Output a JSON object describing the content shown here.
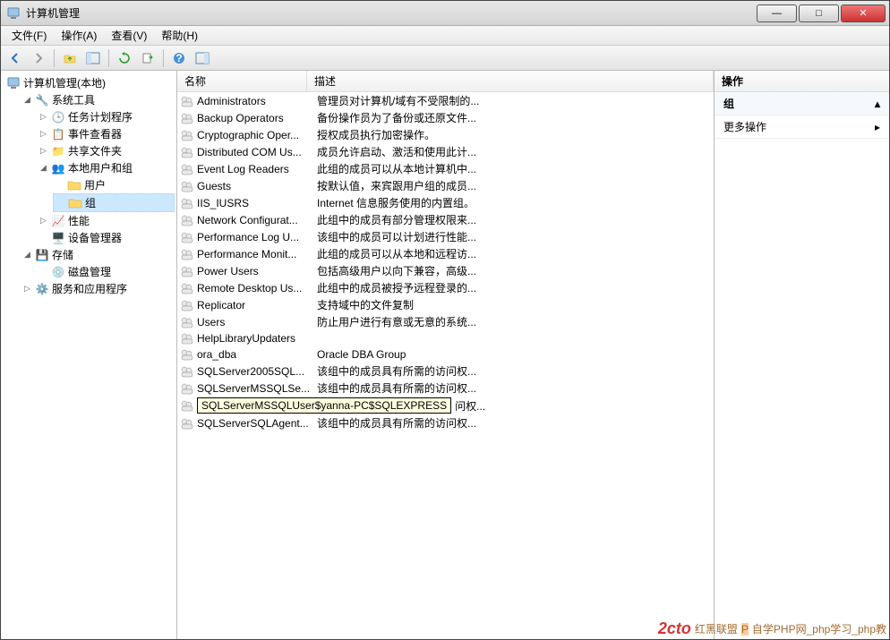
{
  "window": {
    "title": "计算机管理"
  },
  "menu": {
    "file": "文件(F)",
    "action": "操作(A)",
    "view": "查看(V)",
    "help": "帮助(H)"
  },
  "tree": {
    "root": "计算机管理(本地)",
    "tools": "系统工具",
    "task": "任务计划程序",
    "event": "事件查看器",
    "share": "共享文件夹",
    "usersgroups": "本地用户和组",
    "users": "用户",
    "groups": "组",
    "perf": "性能",
    "devmgr": "设备管理器",
    "storage": "存储",
    "diskmgr": "磁盘管理",
    "services": "服务和应用程序"
  },
  "list": {
    "header_name": "名称",
    "header_desc": "描述",
    "rows": [
      {
        "name": "Administrators",
        "desc": "管理员对计算机/域有不受限制的..."
      },
      {
        "name": "Backup Operators",
        "desc": "备份操作员为了备份或还原文件..."
      },
      {
        "name": "Cryptographic Oper...",
        "desc": "授权成员执行加密操作。"
      },
      {
        "name": "Distributed COM Us...",
        "desc": "成员允许启动、激活和使用此计..."
      },
      {
        "name": "Event Log Readers",
        "desc": "此组的成员可以从本地计算机中..."
      },
      {
        "name": "Guests",
        "desc": "按默认值，来宾跟用户组的成员..."
      },
      {
        "name": "IIS_IUSRS",
        "desc": "Internet 信息服务使用的内置组。"
      },
      {
        "name": "Network Configurat...",
        "desc": "此组中的成员有部分管理权限来..."
      },
      {
        "name": "Performance Log U...",
        "desc": "该组中的成员可以计划进行性能..."
      },
      {
        "name": "Performance Monit...",
        "desc": "此组的成员可以从本地和远程访..."
      },
      {
        "name": "Power Users",
        "desc": "包括高级用户以向下兼容，高级..."
      },
      {
        "name": "Remote Desktop Us...",
        "desc": "此组中的成员被授予远程登录的..."
      },
      {
        "name": "Replicator",
        "desc": "支持域中的文件复制"
      },
      {
        "name": "Users",
        "desc": "防止用户进行有意或无意的系统..."
      },
      {
        "name": "HelpLibraryUpdaters",
        "desc": ""
      },
      {
        "name": "ora_dba",
        "desc": "Oracle DBA Group"
      },
      {
        "name": "SQLServer2005SQL...",
        "desc": "该组中的成员具有所需的访问权..."
      },
      {
        "name": "SQLServerMSSQLSe...",
        "desc": "该组中的成员具有所需的访问权..."
      },
      {
        "name": "SQLServerMSSQLUser$yanna-PC$SQLEXPRESS",
        "desc": "问权...",
        "tooltip": true
      },
      {
        "name": "SQLServerSQLAgent...",
        "desc": "该组中的成员具有所需的访问权..."
      }
    ]
  },
  "actions": {
    "header": "操作",
    "section": "组",
    "more": "更多操作"
  },
  "watermark": {
    "logo": "2cto",
    "text1": "红黑联盟",
    "text2": "自学PHP网_php学习_php教"
  }
}
